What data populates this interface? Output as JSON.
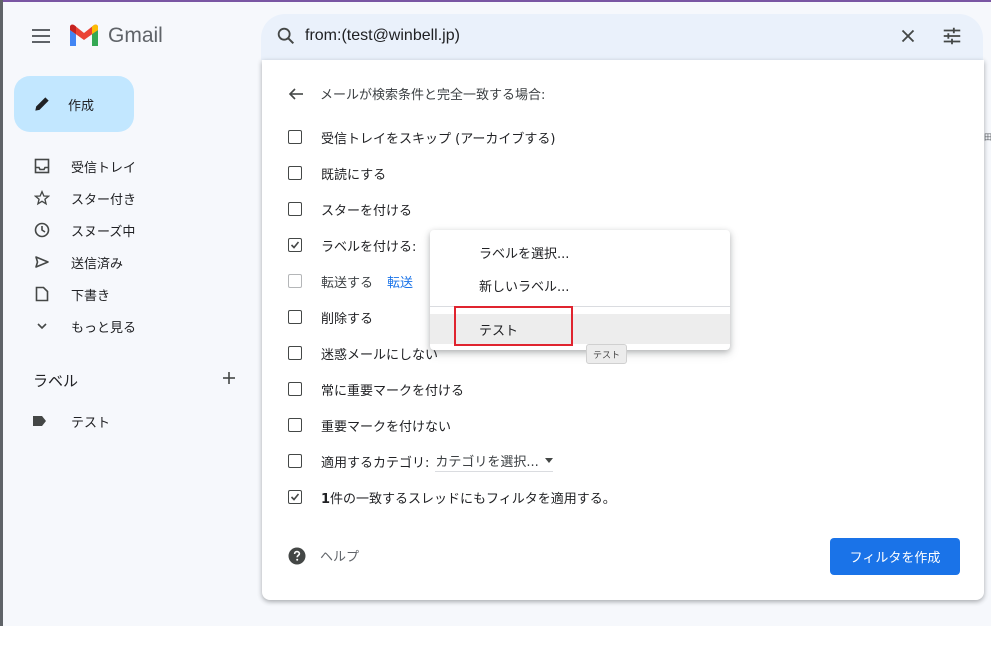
{
  "header": {
    "app_name": "Gmail",
    "search_value": "from:(test@winbell.jp)"
  },
  "sidebar": {
    "compose_label": "作成",
    "items": [
      {
        "label": "受信トレイ",
        "icon": "inbox-icon"
      },
      {
        "label": "スター付き",
        "icon": "star-icon"
      },
      {
        "label": "スヌーズ中",
        "icon": "clock-icon"
      },
      {
        "label": "送信済み",
        "icon": "send-icon"
      },
      {
        "label": "下書き",
        "icon": "draft-icon"
      },
      {
        "label": "もっと見る",
        "icon": "chevron-down-icon"
      }
    ],
    "labels_title": "ラベル",
    "labels": [
      {
        "label": "テスト",
        "icon": "label-icon"
      }
    ]
  },
  "filter": {
    "heading": "メールが検索条件と完全一致する場合:",
    "options": {
      "skip_inbox": {
        "label": "受信トレイをスキップ (アーカイブする)",
        "checked": false
      },
      "mark_read": {
        "label": "既読にする",
        "checked": false
      },
      "star": {
        "label": "スターを付ける",
        "checked": false
      },
      "apply_label": {
        "label": "ラベルを付ける:",
        "checked": true
      },
      "forward": {
        "label": "転送する",
        "link": "転送",
        "checked": false,
        "disabled": true
      },
      "delete": {
        "label": "削除する",
        "checked": false
      },
      "never_spam": {
        "label": "迷惑メールにしない",
        "checked": false
      },
      "always_important": {
        "label": "常に重要マークを付ける",
        "checked": false
      },
      "never_important": {
        "label": "重要マークを付けない",
        "checked": false
      },
      "category": {
        "label": "適用するカテゴリ:",
        "select": "カテゴリを選択...",
        "checked": false
      },
      "apply_existing": {
        "count": "1",
        "label": "件の一致するスレッドにもフィルタを適用する。",
        "checked": true
      }
    },
    "help_label": "ヘルプ",
    "create_button": "フィルタを作成"
  },
  "label_dropdown": {
    "choose": "ラベルを選択...",
    "new_label": "新しいラベル...",
    "items": [
      "テスト"
    ],
    "tooltip": "テスト"
  },
  "side_panel_glyph": "田",
  "colors": {
    "accent": "#1a73e8",
    "compose_bg": "#c2e7ff",
    "highlight_box": "#e0242f",
    "app_bg": "#f6f8fc"
  }
}
